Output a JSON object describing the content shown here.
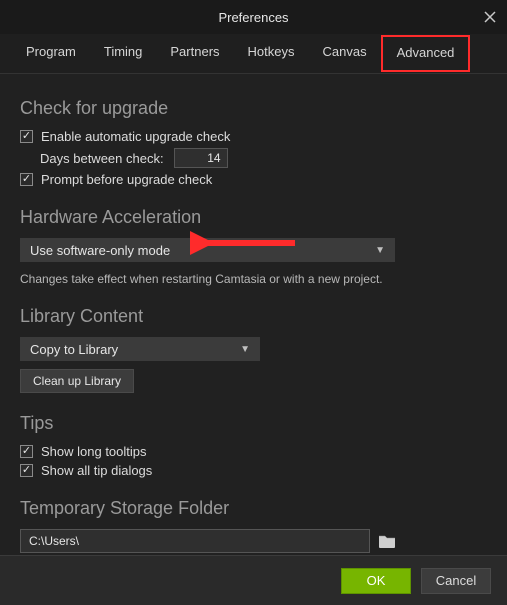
{
  "window": {
    "title": "Preferences"
  },
  "tabs": {
    "items": [
      "Program",
      "Timing",
      "Partners",
      "Hotkeys",
      "Canvas",
      "Advanced"
    ],
    "active": "Advanced"
  },
  "sections": {
    "upgrade": {
      "heading": "Check for upgrade",
      "enable_label": "Enable automatic upgrade check",
      "days_label": "Days between check:",
      "days_value": "14",
      "prompt_label": "Prompt before upgrade check"
    },
    "hwaccel": {
      "heading": "Hardware Acceleration",
      "dropdown_value": "Use software-only mode",
      "note": "Changes take effect when restarting Camtasia or with a new project."
    },
    "library": {
      "heading": "Library Content",
      "dropdown_value": "Copy to Library",
      "cleanup_label": "Clean up Library"
    },
    "tips": {
      "heading": "Tips",
      "long_tooltips_label": "Show long tooltips",
      "all_dialogs_label": "Show all tip dialogs"
    },
    "temp": {
      "heading": "Temporary Storage Folder",
      "path_value": "C:\\Users\\"
    }
  },
  "footer": {
    "ok": "OK",
    "cancel": "Cancel"
  }
}
